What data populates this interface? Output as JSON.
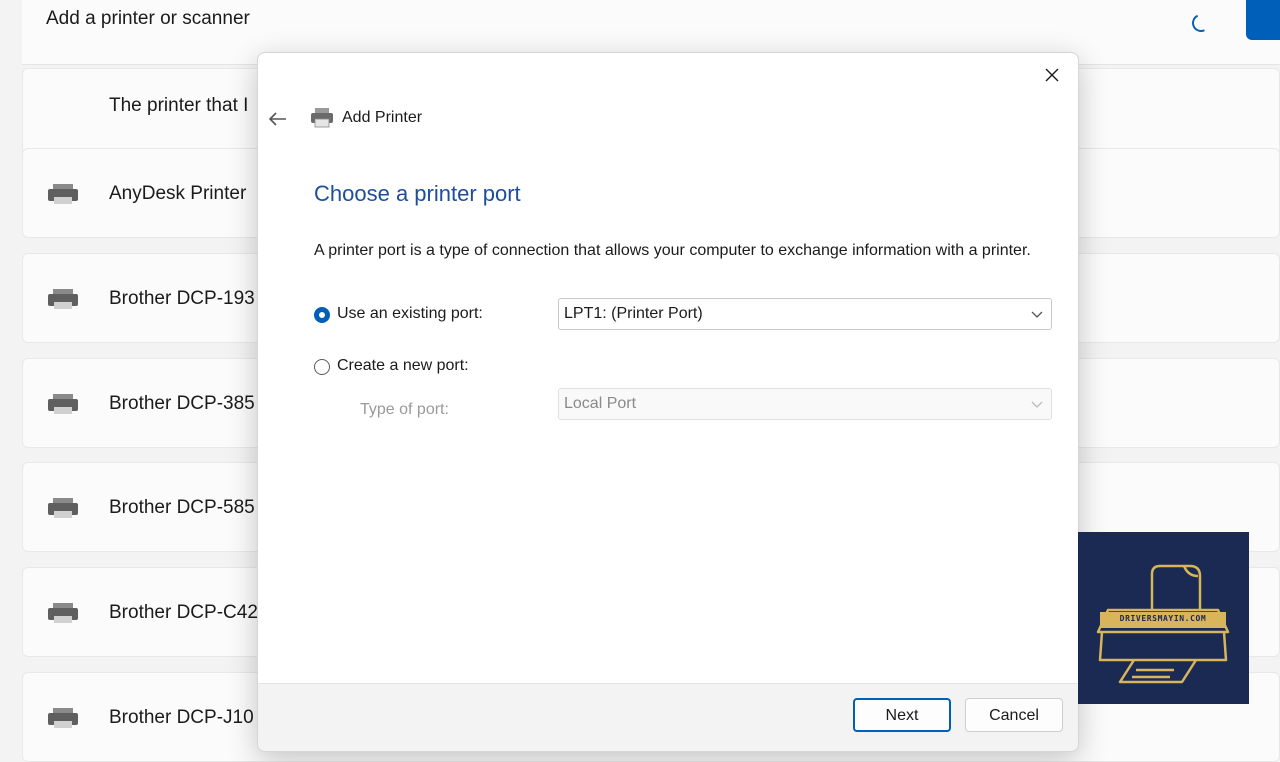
{
  "background": {
    "header_title": "Add a printer or scanner",
    "note_text": "The printer that I",
    "printers": [
      {
        "label": "AnyDesk Printer"
      },
      {
        "label": "Brother DCP-193"
      },
      {
        "label": "Brother DCP-385"
      },
      {
        "label": "Brother DCP-585"
      },
      {
        "label": "Brother DCP-C42"
      },
      {
        "label": "Brother DCP-J10"
      }
    ]
  },
  "dialog": {
    "title": "Add Printer",
    "heading": "Choose a printer port",
    "description": "A printer port is a type of connection that allows your computer to exchange information with a printer.",
    "use_existing": {
      "label": "Use an existing port:",
      "selected": true,
      "value": "LPT1: (Printer Port)"
    },
    "create_new": {
      "label": "Create a new port:",
      "selected": false
    },
    "type_of_port": {
      "label": "Type of port:",
      "value": "Local Port"
    },
    "buttons": {
      "next": "Next",
      "cancel": "Cancel"
    }
  },
  "watermark": {
    "text": "DRIVERSMAYIN.COM"
  },
  "colors": {
    "accent": "#005fb8",
    "heading": "#1f4e99",
    "logo_bg": "#1a2a52",
    "logo_gold": "#d8b45a"
  }
}
